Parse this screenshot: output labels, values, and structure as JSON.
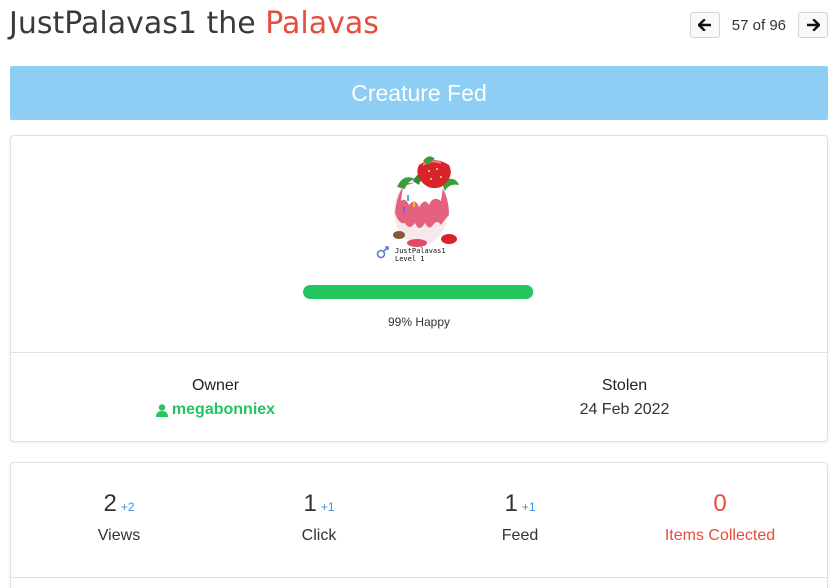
{
  "header": {
    "creature_name": "JustPalavas1",
    "the": "the",
    "species": "Palavas",
    "pager": {
      "current": "57",
      "of": "of",
      "total": "96"
    }
  },
  "banner": {
    "text": "Creature Fed"
  },
  "creature": {
    "sprite_name": "JustPalavas1",
    "sprite_level": "Level 1",
    "happiness_pct": 99,
    "happiness_text": "99% Happy"
  },
  "info": {
    "owner_label": "Owner",
    "owner_name": "megabonniex",
    "stolen_label": "Stolen",
    "stolen_date": "24 Feb 2022"
  },
  "stats": [
    {
      "value": "2",
      "delta": "+2",
      "label": "Views"
    },
    {
      "value": "1",
      "delta": "+1",
      "label": "Click"
    },
    {
      "value": "1",
      "delta": "+1",
      "label": "Feed"
    },
    {
      "value": "0",
      "delta": "",
      "label": "Items Collected"
    }
  ],
  "colors": {
    "species": "#e74c3c",
    "banner_bg": "#8ecdf4",
    "happy_bar": "#22c55e",
    "owner_link": "#22c55e",
    "delta": "#3b8ed8",
    "items_collected": "#e74c3c"
  },
  "icons": {
    "prev": "arrow-left-icon",
    "next": "arrow-right-icon",
    "owner": "user-icon",
    "gender": "male-gender-icon"
  }
}
